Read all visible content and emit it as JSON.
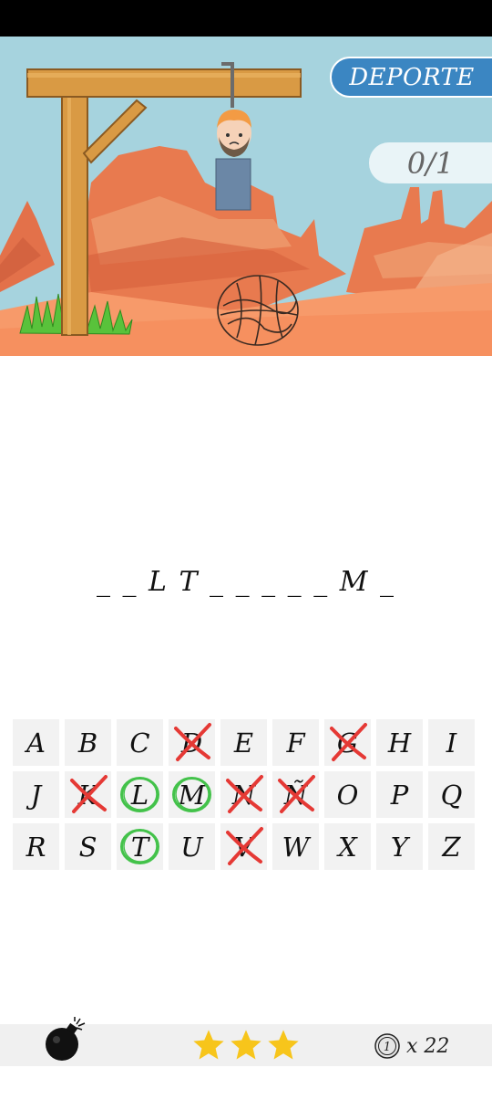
{
  "category": {
    "label": "DEPORTE"
  },
  "score": {
    "label": "0/1"
  },
  "word": {
    "display": "_ _ L T _ _ _ _ _ M _"
  },
  "keyboard": {
    "rows": [
      [
        {
          "letter": "A",
          "state": "unused"
        },
        {
          "letter": "B",
          "state": "unused"
        },
        {
          "letter": "C",
          "state": "unused"
        },
        {
          "letter": "D",
          "state": "wrong"
        },
        {
          "letter": "E",
          "state": "unused"
        },
        {
          "letter": "F",
          "state": "unused"
        },
        {
          "letter": "G",
          "state": "wrong"
        },
        {
          "letter": "H",
          "state": "unused"
        },
        {
          "letter": "I",
          "state": "unused"
        }
      ],
      [
        {
          "letter": "J",
          "state": "unused"
        },
        {
          "letter": "K",
          "state": "wrong"
        },
        {
          "letter": "L",
          "state": "correct"
        },
        {
          "letter": "M",
          "state": "correct"
        },
        {
          "letter": "N",
          "state": "wrong"
        },
        {
          "letter": "Ñ",
          "state": "wrong"
        },
        {
          "letter": "O",
          "state": "unused"
        },
        {
          "letter": "P",
          "state": "unused"
        },
        {
          "letter": "Q",
          "state": "unused"
        }
      ],
      [
        {
          "letter": "R",
          "state": "unused"
        },
        {
          "letter": "S",
          "state": "unused"
        },
        {
          "letter": "T",
          "state": "correct"
        },
        {
          "letter": "U",
          "state": "unused"
        },
        {
          "letter": "V",
          "state": "wrong"
        },
        {
          "letter": "W",
          "state": "unused"
        },
        {
          "letter": "X",
          "state": "unused"
        },
        {
          "letter": "Y",
          "state": "unused"
        },
        {
          "letter": "Z",
          "state": "unused"
        }
      ]
    ]
  },
  "bottom": {
    "bomb_icon": "bomb-icon",
    "stars": 3,
    "coin_icon": "coin-icon",
    "coin_value": "1",
    "coin_count": "x 22"
  },
  "colors": {
    "sky": "#a6d3de",
    "ground": "#f79a6a",
    "category_bg": "#3b86c2",
    "wrong_mark": "#e53935",
    "correct_mark": "#43c24a",
    "star": "#f7c51b"
  }
}
